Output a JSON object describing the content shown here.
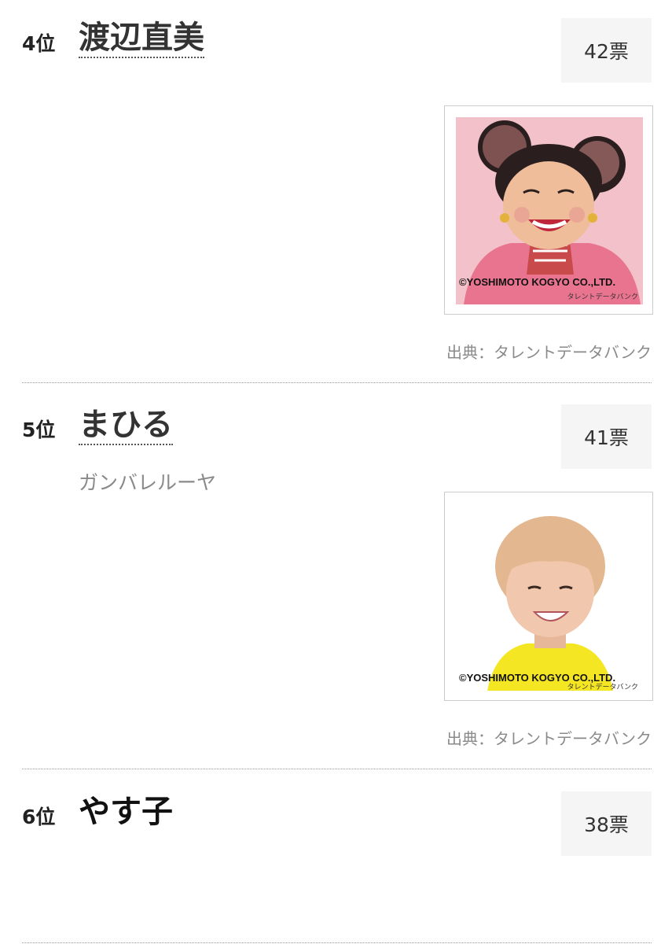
{
  "entries": [
    {
      "rank": "4位",
      "name": "渡辺直美",
      "votes": "42票",
      "group": "",
      "photo": {
        "copyright": "©YOSHIMOTO KOGYO CO.,LTD.",
        "watermark": "タレントデータバンク"
      },
      "credit": "出典：タレントデータバンク"
    },
    {
      "rank": "5位",
      "name": "まひる",
      "votes": "41票",
      "group": "ガンバレルーヤ",
      "photo": {
        "copyright": "©YOSHIMOTO KOGYO CO.,LTD.",
        "watermark": "タレントデータバンク"
      },
      "credit": "出典：タレントデータバンク"
    },
    {
      "rank": "6位",
      "name": "やす子",
      "votes": "38票",
      "group": ""
    }
  ],
  "colors": {
    "vote_box_bg": "#f5f5f5",
    "muted_text": "#8a8a8a",
    "photo1_bg": "#f2b9c2",
    "photo2_shirt": "#f5e623"
  }
}
